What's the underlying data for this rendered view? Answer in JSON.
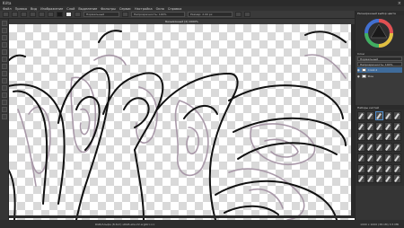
{
  "window": {
    "title": "Krita",
    "close_glyph": "×"
  },
  "menubar": [
    "Файл",
    "Правка",
    "Вид",
    "Изображение",
    "Слой",
    "Выделение",
    "Фильтры",
    "Сервис",
    "Настройка",
    "Окно",
    "Справка"
  ],
  "toolbar": {
    "blend_mode": "Нормальный",
    "opacity": "Непрозрачность: 100%",
    "size": "Размер: 2.00 px"
  },
  "document": {
    "tab_title": "Безымянный [2] 1000%"
  },
  "toolbox_icons": [
    "select-icon",
    "brush-icon",
    "line-icon",
    "rect-icon",
    "ellipse-icon",
    "fill-icon",
    "gradient-icon",
    "move-icon",
    "transform-icon",
    "crop-icon",
    "text-icon",
    "eyedropper-icon",
    "zoom-icon",
    "pan-icon"
  ],
  "dock": {
    "color_header": "Расширенный выбор цвета",
    "layers_header": "Слои",
    "blend_mode": "Нормальный",
    "opacity": "Непрозрачность: 100%",
    "layers": [
      {
        "name": "Слой 2",
        "active": true
      },
      {
        "name": "Фон",
        "active": false
      }
    ],
    "presets_header": "Наборы кистей"
  },
  "statusbar": {
    "left": "RGB/Альфа (8-бит) sRGB-elle-V2-srgbtrc.icc",
    "center": "",
    "right": "1000 x 1000 (38.1M) 3.5 МБ"
  },
  "colors": {
    "accent": "#3f6b9a",
    "panel": "#353535",
    "canvas_bg": "#ffffff"
  }
}
